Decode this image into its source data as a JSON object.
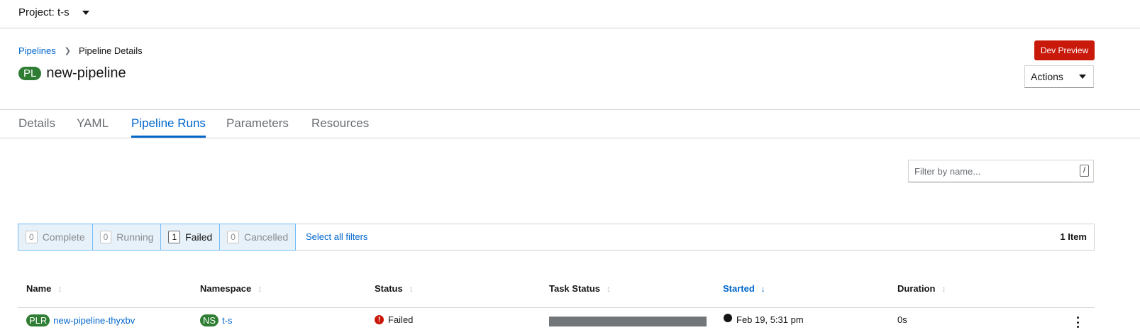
{
  "project": {
    "label": "Project: t-s"
  },
  "breadcrumb": {
    "parent": "Pipelines",
    "current": "Pipeline Details"
  },
  "page": {
    "badge": "PL",
    "title": "new-pipeline"
  },
  "header": {
    "dev_preview": "Dev Preview",
    "actions": "Actions"
  },
  "tabs": [
    {
      "label": "Details",
      "active": false
    },
    {
      "label": "YAML",
      "active": false
    },
    {
      "label": "Pipeline Runs",
      "active": true
    },
    {
      "label": "Parameters",
      "active": false
    },
    {
      "label": "Resources",
      "active": false
    }
  ],
  "filter": {
    "placeholder": "Filter by name...",
    "shortcut": "/"
  },
  "status_filters": [
    {
      "count": "0",
      "label": "Complete",
      "selected": false
    },
    {
      "count": "0",
      "label": "Running",
      "selected": false
    },
    {
      "count": "1",
      "label": "Failed",
      "selected": true
    },
    {
      "count": "0",
      "label": "Cancelled",
      "selected": false
    }
  ],
  "select_all": "Select all filters",
  "item_count": "1 Item",
  "table": {
    "columns": [
      "Name",
      "Namespace",
      "Status",
      "Task Status",
      "Started",
      "Duration"
    ],
    "sorted_column": "Started",
    "rows": [
      {
        "name_badge": "PLR",
        "name": "new-pipeline-thyxbv",
        "namespace_badge": "NS",
        "namespace": "t-s",
        "status": "Failed",
        "task_status_color": "#737679",
        "started": "Feb 19, 5:31 pm",
        "duration": "0s"
      }
    ]
  },
  "colors": {
    "link": "#0066cc",
    "badge": "#2e7d32",
    "danger": "#c9190b",
    "chip_bg": "#e7f1fa",
    "chip_border": "#73bcf7"
  }
}
